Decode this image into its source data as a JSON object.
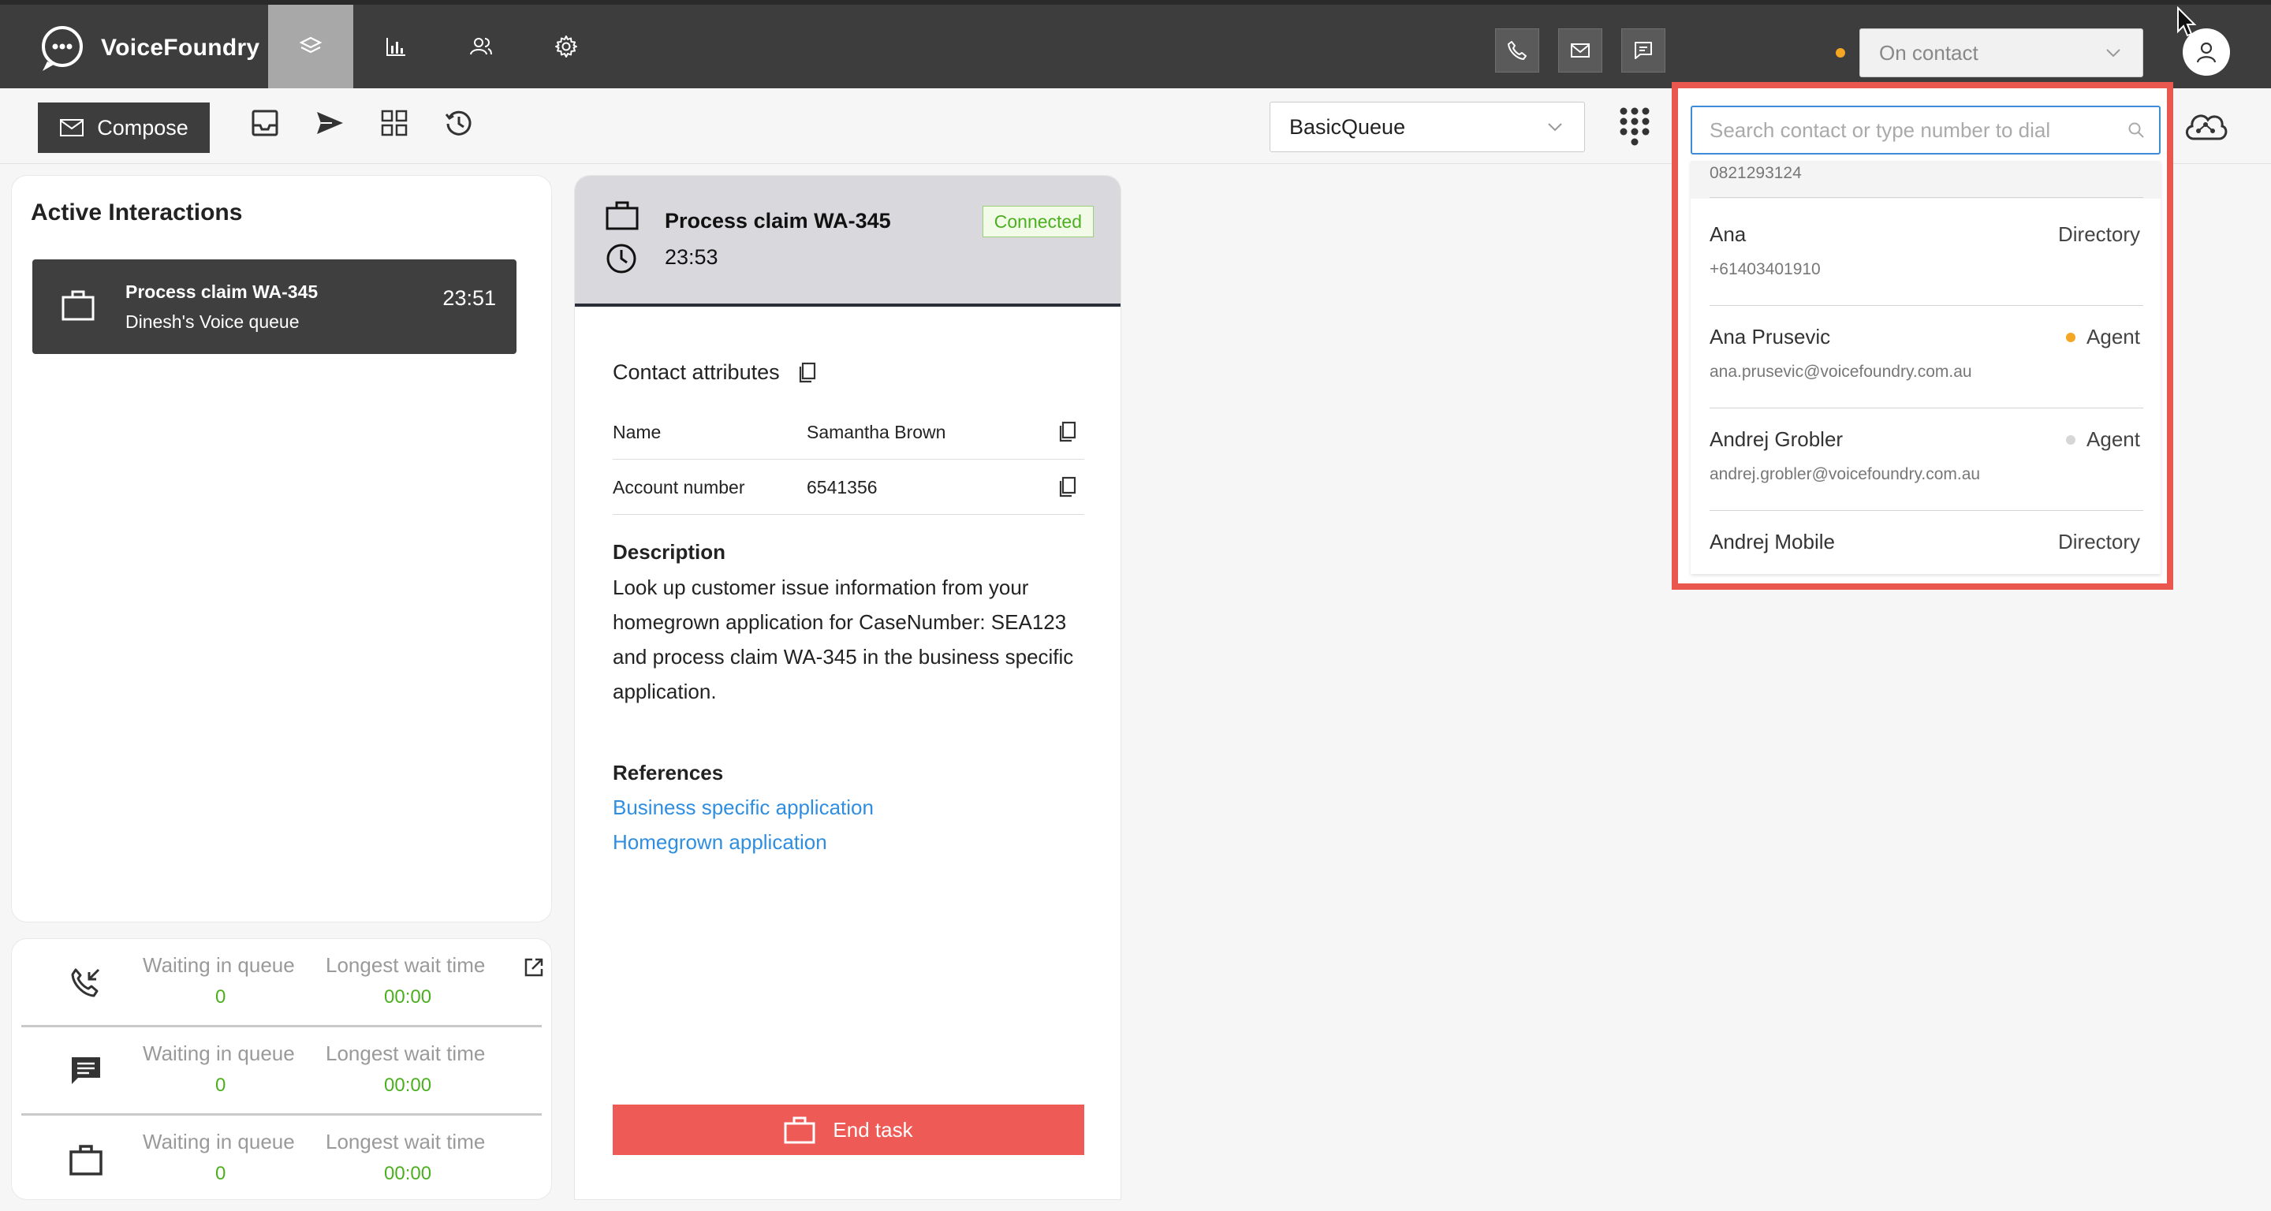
{
  "app": {
    "name": "VoiceFoundry",
    "nav": [
      "interactions",
      "reports",
      "contacts",
      "settings"
    ],
    "channels": [
      "phone-icon",
      "mail-icon",
      "chat-icon"
    ],
    "status": {
      "label": "On contact",
      "color": "#f5a623"
    }
  },
  "toolbar": {
    "compose_label": "Compose",
    "queue": "BasicQueue",
    "icons": [
      "inbox-icon",
      "send-icon",
      "grid-icon",
      "history-icon"
    ]
  },
  "active_interactions": {
    "title": "Active Interactions",
    "items": [
      {
        "title": "Process claim WA-345",
        "queue": "Dinesh's Voice queue",
        "time": "23:51"
      }
    ]
  },
  "queue_stats": [
    {
      "icon": "incoming-call-icon",
      "waiting_label": "Waiting in queue",
      "waiting": "0",
      "longest_label": "Longest wait time",
      "longest": "00:00"
    },
    {
      "icon": "chat-icon",
      "waiting_label": "Waiting in queue",
      "waiting": "0",
      "longest_label": "Longest wait time",
      "longest": "00:00"
    },
    {
      "icon": "task-icon",
      "waiting_label": "Waiting in queue",
      "waiting": "0",
      "longest_label": "Longest wait time",
      "longest": "00:00"
    }
  ],
  "task": {
    "title": "Process claim WA-345",
    "time": "23:53",
    "state": "Connected",
    "contact_attributes_title": "Contact attributes",
    "attributes": [
      {
        "key": "Name",
        "value": "Samantha Brown"
      },
      {
        "key": "Account number",
        "value": "6541356"
      }
    ],
    "description_title": "Description",
    "description": "Look up customer issue information from your homegrown application for CaseNumber: SEA123 and process claim WA-345 in the business specific application.",
    "references_title": "References",
    "references": [
      "Business specific application",
      "Homegrown application"
    ],
    "end_label": "End task"
  },
  "search": {
    "placeholder": "Search contact or type number to dial",
    "partial_sub": "0821293124",
    "results": [
      {
        "name": "Ana",
        "sub": "+61403401910",
        "type": "Directory",
        "dot": ""
      },
      {
        "name": "Ana Prusevic",
        "sub": "ana.prusevic@voicefoundry.com.au",
        "type": "Agent",
        "dot": "#f5a623"
      },
      {
        "name": "Andrej Grobler",
        "sub": "andrej.grobler@voicefoundry.com.au",
        "type": "Agent",
        "dot": "#d6d6d6"
      },
      {
        "name": "Andrej Mobile",
        "sub": "",
        "type": "Directory",
        "dot": ""
      }
    ]
  }
}
